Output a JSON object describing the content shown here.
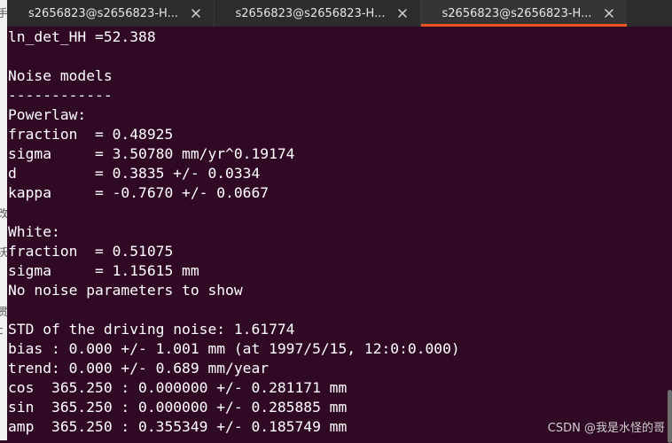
{
  "tabs": [
    {
      "label": "s2656823@s2656823-H...",
      "active": false
    },
    {
      "label": "s2656823@s2656823-H...",
      "active": false
    },
    {
      "label": "s2656823@s2656823-H...",
      "active": true
    }
  ],
  "tab_close_icon": "close-icon",
  "accent_color": "#e95420",
  "terminal_background": "#300a24",
  "terminal_lines": [
    "ln_det_HH =52.388",
    "",
    "Noise models",
    "------------",
    "Powerlaw:",
    "fraction  = 0.48925",
    "sigma     = 3.50780 mm/yr^0.19174",
    "d         = 0.3835 +/- 0.0334",
    "kappa     = -0.7670 +/- 0.0667",
    "",
    "White:",
    "fraction  = 0.51075",
    "sigma     = 1.15615 mm",
    "No noise parameters to show",
    "",
    "STD of the driving noise: 1.61774",
    "bias : 0.000 +/- 1.001 mm (at 1997/5/15, 12:0:0.000)",
    "trend: 0.000 +/- 0.689 mm/year",
    "cos  365.250 : 0.000000 +/- 0.281171 mm",
    "sin  365.250 : 0.000000 +/- 0.285885 mm",
    "amp  365.250 : 0.355349 +/- 0.185749 mm"
  ],
  "left_edge_glyphs": [
    "手",
    "改",
    "沃",
    "贯",
    "c"
  ],
  "watermark": "CSDN @我是水怪的哥"
}
